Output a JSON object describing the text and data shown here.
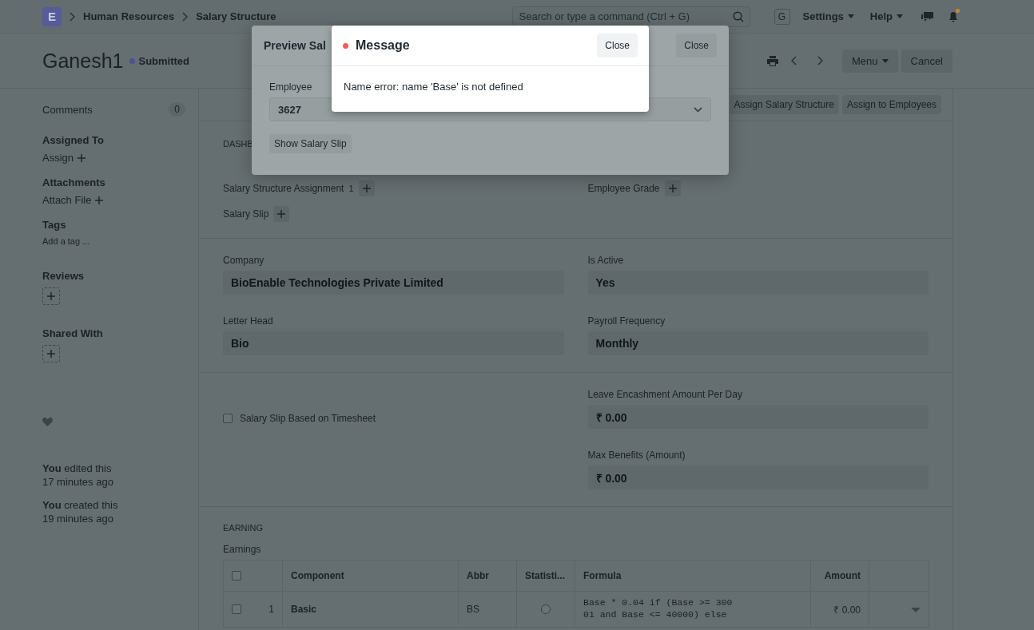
{
  "navbar": {
    "logo": "E",
    "breadcrumbs": [
      "Human Resources",
      "Salary Structure"
    ],
    "search": {
      "placeholder": "Search or type a command (Ctrl + G)"
    },
    "avatar": "G",
    "menus": [
      "Settings",
      "Help"
    ],
    "has_notification": true
  },
  "page_header": {
    "title": "Ganesh1",
    "status": "Submitted",
    "buttons": [
      "Menu",
      "Cancel"
    ]
  },
  "sidebar": {
    "comments": {
      "label": "Comments",
      "count": "0"
    },
    "sections": [
      {
        "kind": "link",
        "title": "Assigned To",
        "action": "Assign"
      },
      {
        "kind": "link",
        "title": "Attachments",
        "action": "Attach File"
      },
      {
        "kind": "tags",
        "title": "Tags",
        "placeholder": "Add a tag ..."
      },
      {
        "kind": "add_box",
        "title": "Reviews"
      },
      {
        "kind": "add_box",
        "title": "Shared With"
      }
    ],
    "activity": [
      {
        "text": "**You** edited this",
        "time": "17 minutes ago"
      },
      {
        "text": "**You** created this",
        "time": "19 minutes ago"
      }
    ]
  },
  "toolbar": [
    "Assign Salary Structure",
    "Assign to Employees"
  ],
  "dashboard": {
    "heading": "DASHB",
    "links_left": [
      {
        "label": "Salary Structure Assignment",
        "count": "1"
      },
      {
        "label": "Salary Slip"
      }
    ],
    "links_right": [
      {
        "label": "Employee Grade"
      }
    ]
  },
  "details": {
    "left": [
      {
        "label": "Company",
        "value": "BioEnable Technologies Private Limited"
      },
      {
        "label": "Letter Head",
        "value": "Bio"
      }
    ],
    "right": [
      {
        "label": "Is Active",
        "value": "Yes"
      },
      {
        "label": "Payroll Frequency",
        "value": "Monthly"
      }
    ]
  },
  "options": {
    "checkbox": {
      "label": "Salary Slip Based on Timesheet",
      "checked": false
    },
    "right": [
      {
        "label": "Leave Encashment Amount Per Day",
        "value": "₹ 0.00"
      },
      {
        "label": "Max Benefits (Amount)",
        "value": "₹ 0.00"
      }
    ]
  },
  "earnings": {
    "heading": "EARNING",
    "label": "Earnings",
    "select_all": false,
    "columns": [
      "Component",
      "Abbr",
      "Statisti...",
      "Formula",
      "Amount"
    ],
    "rows": [
      {
        "selected": false,
        "index": "1",
        "component": "Basic",
        "abbr": "BS",
        "statistical": false,
        "formula": "Base * 0.04 if (Base >= 30001 and Base <= 40000) else",
        "amount": "₹ 0.00"
      }
    ]
  },
  "preview_dialog": {
    "title": "Preview Sal",
    "close": "Close",
    "field": {
      "label": "Employee",
      "value": "3627"
    },
    "button": "Show Salary Slip"
  },
  "message_dialog": {
    "title": "Message",
    "close": "Close",
    "text": "Name error: name 'Base' is not defined"
  }
}
